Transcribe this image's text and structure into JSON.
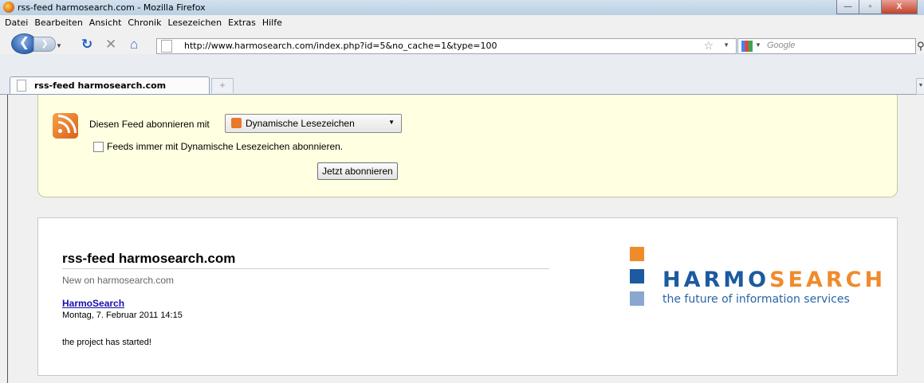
{
  "window": {
    "title": "rss-feed harmosearch.com - Mozilla Firefox",
    "minimize_glyph": "—",
    "maximize_glyph": "▫",
    "close_glyph": "X"
  },
  "menu": [
    "Datei",
    "Bearbeiten",
    "Ansicht",
    "Chronik",
    "Lesezeichen",
    "Extras",
    "Hilfe"
  ],
  "nav": {
    "back_glyph": "❮",
    "forward_glyph": "❯",
    "url": "http://www.harmosearch.com/index.php?id=5&no_cache=1&type=100",
    "search_placeholder": "Google",
    "icons": [
      "back-icon",
      "forward-icon",
      "reload-icon",
      "stop-icon",
      "home-icon",
      "bookmark-star-icon",
      "search-engine-icon",
      "search-go-icon"
    ]
  },
  "tabs": [
    {
      "title": "rss-feed harmosearch.com",
      "active": true
    }
  ],
  "new_tab_glyph": "+",
  "feed_subscribe": {
    "label": "Diesen Feed abonnieren mit",
    "reader": "Dynamische Lesezeichen",
    "always_label": "Feeds immer mit Dynamische Lesezeichen abonnieren.",
    "always_checked": false,
    "button": "Jetzt abonnieren"
  },
  "feed": {
    "title": "rss-feed harmosearch.com",
    "subtitle": "New on harmosearch.com",
    "entries": [
      {
        "title": "HarmoSearch",
        "date": "Montag, 7. Februar 2011 14:15",
        "text": "the project has started!"
      }
    ]
  },
  "logo": {
    "word_part1": "HARMO",
    "word_part2": "SEARCH",
    "tagline": "the future of information services",
    "colors": {
      "orange": "#f08b2c",
      "blue": "#1d5aa0",
      "light_blue": "#8aa8cf"
    }
  }
}
